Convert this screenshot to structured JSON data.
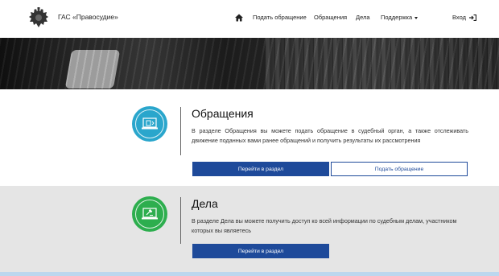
{
  "header": {
    "brand": "ГАС «Правосудие»",
    "nav": {
      "submit": "Подать обращение",
      "appeals": "Обращения",
      "cases": "Дела",
      "support": "Поддержка",
      "login": "Вход"
    }
  },
  "sections": [
    {
      "title": "Обращения",
      "text": "В разделе Обращения вы можете подать обращение в судебный орган, а также отслеживать движение поданных вами ранее обращений и получить результаты их рассмотрения",
      "primary_button": "Перейти в раздел",
      "secondary_button": "Подать обращение",
      "icon": "laptop-document-icon",
      "color": "#2aa6cc"
    },
    {
      "title": "Дела",
      "text": "В разделе Дела вы можете получить доступ ко всей информации по судебным делам, участником которых вы являетесь",
      "primary_button": "Перейти в раздел",
      "icon": "laptop-gavel-icon",
      "color": "#2dae4e"
    }
  ],
  "colors": {
    "primary": "#1e4a9a",
    "section_alt_bg": "#e5e5e5"
  }
}
